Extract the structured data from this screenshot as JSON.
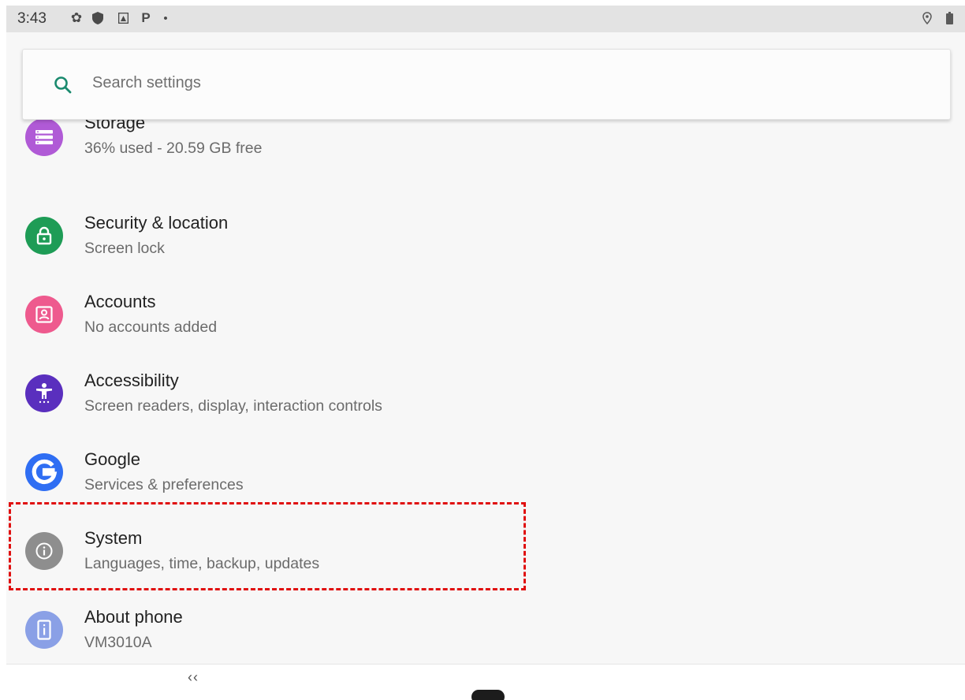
{
  "status_bar": {
    "time": "3:43",
    "left_icons": [
      "gear-icon",
      "shield-icon",
      "sim-card-icon",
      "p-icon",
      "dot-icon"
    ],
    "right_icons": [
      "location-icon",
      "battery-icon"
    ]
  },
  "search": {
    "placeholder": "Search settings"
  },
  "settings": [
    {
      "title": "Storage",
      "subtitle": "36% used - 20.59 GB free",
      "icon": "storage-icon",
      "color": "#b05ad6"
    },
    {
      "title": "Security & location",
      "subtitle": "Screen lock",
      "icon": "lock-icon",
      "color": "#1e9c56"
    },
    {
      "title": "Accounts",
      "subtitle": "No accounts added",
      "icon": "account-box-icon",
      "color": "#ee5a8e"
    },
    {
      "title": "Accessibility",
      "subtitle": "Screen readers, display, interaction controls",
      "icon": "accessibility-icon",
      "color": "#5a2fbe"
    },
    {
      "title": "Google",
      "subtitle": "Services & preferences",
      "icon": "google-icon",
      "color": "#2f6ef3"
    },
    {
      "title": "System",
      "subtitle": "Languages, time, backup, updates",
      "icon": "info-icon",
      "color": "#8e8e8e"
    },
    {
      "title": "About phone",
      "subtitle": "VM3010A",
      "icon": "phone-info-icon",
      "color": "#8aa0e6"
    }
  ],
  "nav_bar": {
    "back_glyph": "‹‹"
  },
  "colors": {
    "accent": "#1a8a6e",
    "highlight": "#e01010"
  }
}
